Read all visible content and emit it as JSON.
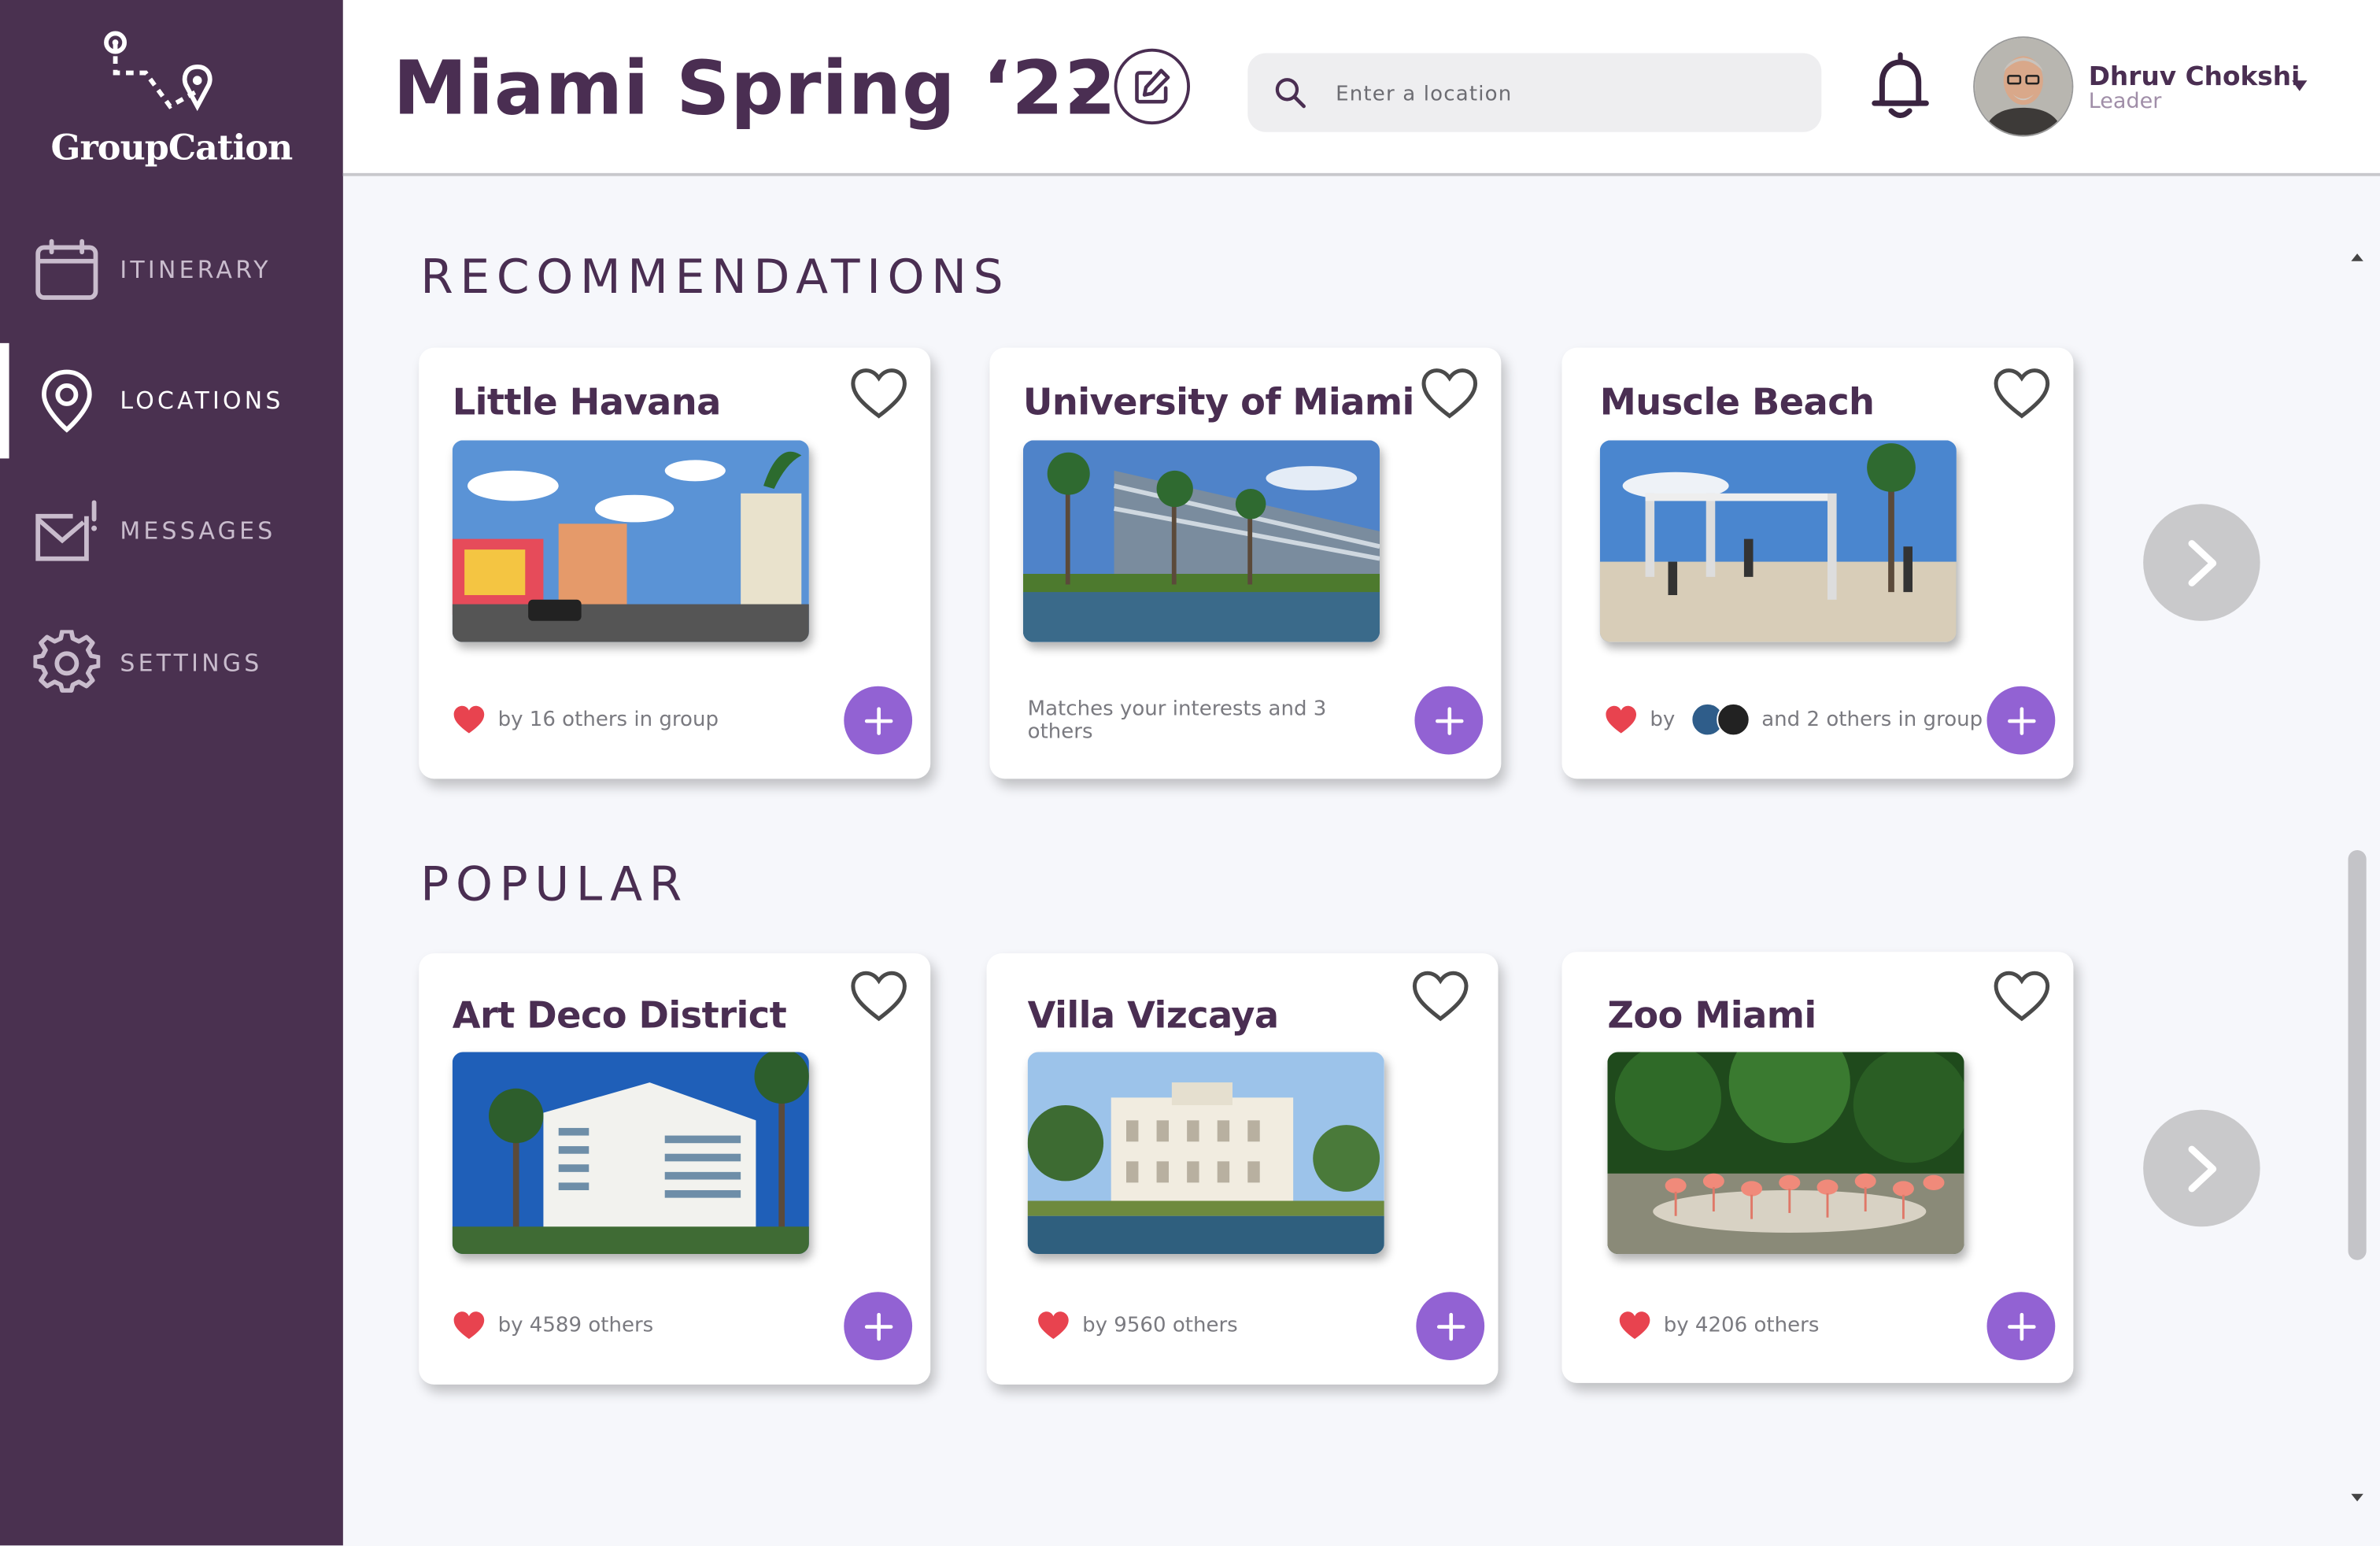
{
  "app": {
    "name": "GroupCation"
  },
  "nav": [
    {
      "label": "ITINERARY",
      "icon": "calendar-icon"
    },
    {
      "label": "LOCATIONS",
      "icon": "map-pin-icon",
      "active": true
    },
    {
      "label": "MESSAGES",
      "icon": "mail-alert-icon"
    },
    {
      "label": "SETTINGS",
      "icon": "gear-icon"
    }
  ],
  "header": {
    "trip_title": "Miami Spring ‘22",
    "search_placeholder": "Enter a location",
    "user": {
      "name": "Dhruv Chokshi",
      "role": "Leader"
    }
  },
  "recommendations": {
    "title": "RECOMMENDATIONS",
    "cards": [
      {
        "title": "Little Havana",
        "footer": "by 16 others in group"
      },
      {
        "title": "University of Miami",
        "footer": "Matches your interests and 3 others"
      },
      {
        "title": "Muscle Beach",
        "footer_prefix": "by",
        "footer": "and 2 others in group"
      }
    ]
  },
  "popular": {
    "title": "POPULAR",
    "cards": [
      {
        "title": "Art Deco District",
        "footer": "by 4589 others"
      },
      {
        "title": "Villa Vizcaya",
        "footer": "by 9560 others"
      },
      {
        "title": "Zoo Miami",
        "footer": "by 4206 others"
      }
    ]
  },
  "colors": {
    "sidebar": "#4a3150",
    "accent": "#9262d3",
    "heart": "#e8434f",
    "title": "#4a2e52"
  }
}
